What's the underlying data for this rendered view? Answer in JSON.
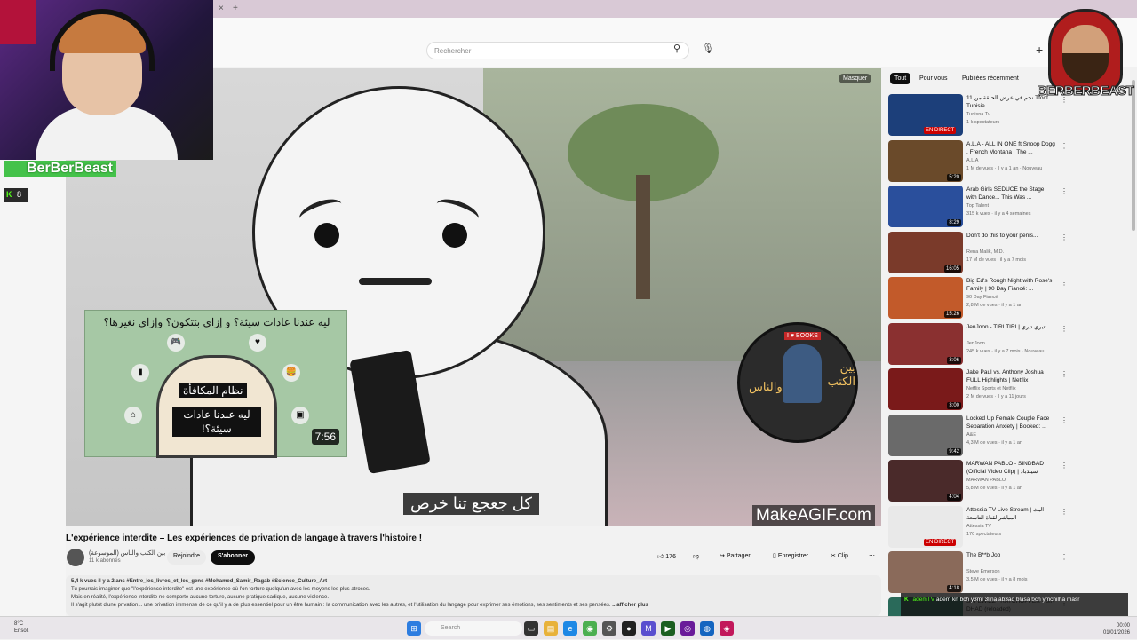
{
  "browser": {
    "tab_close": "×",
    "tab_new": "+"
  },
  "youtube": {
    "search_placeholder": "Rechercher",
    "search_icon": "⚲",
    "mic_icon": "🎙",
    "create_icon": "+"
  },
  "player": {
    "hide_label": "Masquer",
    "subtitle": "كل جعجع تنا خرص",
    "watermark": "MakeAGIF.com",
    "overlay_thumb": {
      "title": "ليه عندنا عادات سيئة؟ و إزاي بتتكون؟ وإزاي نغيرها؟",
      "text1": "نظام المكافأة",
      "text2": "ليه عندنا عادات سيئة؟!",
      "duration": "7:56"
    },
    "channel_logo": {
      "books_label": "I ♥ BOOKS",
      "text_right": "بين الكتب",
      "text_left": "والناس"
    }
  },
  "video": {
    "title": "L'expérience interdite – Les expériences de privation de langage à travers l'histoire !",
    "channel_name": "بين الكتب والناس (الموسوعة)",
    "subscribers": "11 k abonnés",
    "join_label": "Rejoindre",
    "subscribe_label": "S'abonner",
    "likes": "176",
    "share_label": "Partager",
    "save_label": "Enregistrer",
    "clip_label": "Clip",
    "more_label": "⋯",
    "description": {
      "meta": "5,4 k vues  il y a 2 ans  #Entre_les_livres_et_les_gens #Mohamed_Samir_Ragab #Science_Culture_Art",
      "line1": "Tu pourrais imaginer que \"l'expérience interdite\" est une expérience où l'on torture quelqu'un avec les moyens les plus atroces.",
      "line2": "Mais en réalité, l'expérience interdite ne comporte aucune torture, aucune pratique sadique, aucune violence.",
      "line3": "Il s'agit plutôt d'une privation... une privation immense de ce qu'il y a de plus essentiel pour un être humain : la communication avec les autres, et l'utilisation du langage pour exprimer ses émotions, ses sentiments et ses pensées.",
      "more": "...afficher plus"
    }
  },
  "sidebar": {
    "chips": [
      "Tout",
      "Pour vous",
      "Publiées récemment"
    ],
    "recommendations": [
      {
        "title": "11 نجم في عرض الحلقة من Tfoot Tunisie",
        "channel": "Tunisna Tv",
        "meta": "1 k spectateurs",
        "badge": "EN DIRECT",
        "color": "#1c3f7a"
      },
      {
        "title": "A.L.A - ALL IN ONE ft Snoop Dogg , French Montana , The ...",
        "channel": "A.L.A",
        "meta": "1 M de vues · il y a 1 an · Nouveau",
        "badge": "5:20",
        "color": "#6a4a2a"
      },
      {
        "title": "Arab Girls SEDUCE the Stage with Dance... This Was ...",
        "channel": "Top Talent",
        "meta": "315 k vues · il y a 4 semaines",
        "badge": "8:29",
        "color": "#2a4f9c"
      },
      {
        "title": "Don't do this to your penis...",
        "channel": "Rena Malik, M.D.",
        "meta": "17 M de vues · il y a 7 mois",
        "badge": "16:05",
        "color": "#7a3a2a"
      },
      {
        "title": "Big Ed's Rough Night with Rose's Family | 90 Day Fiancé: ...",
        "channel": "90 Day Fiancé",
        "meta": "2,8 M de vues · il y a 1 an",
        "badge": "15:26",
        "color": "#c25a2a"
      },
      {
        "title": "JenJoon - TIRI TIRI | تيري تيري",
        "channel": "JenJoon",
        "meta": "245 k vues · il y a 7 mois · Nouveau",
        "badge": "3:06",
        "color": "#8a3030"
      },
      {
        "title": "Jake Paul vs. Anthony Joshua FULL Highlights | Netflix",
        "channel": "Netflix Sports et Netflix",
        "meta": "2 M de vues · il y a 11 jours",
        "badge": "3:00",
        "color": "#7a1a1a"
      },
      {
        "title": "Locked Up Female Couple Face Separation Anxiety | Booked: ...",
        "channel": "A&E",
        "meta": "4,3 M de vues · il y a 1 an",
        "badge": "9:42",
        "color": "#6a6a6a"
      },
      {
        "title": "MARWAN PABLO - SINDBAD (Official Video Clip) | سيندباد",
        "channel": "MARWAN PABLO",
        "meta": "5,8 M de vues · il y a 1 an",
        "badge": "4:04",
        "color": "#4a2a2a"
      },
      {
        "title": "Attessia TV Live Stream | البث المباشر لقناة التاسعة",
        "channel": "Attessia TV",
        "meta": "170 spectateurs",
        "badge": "EN DIRECT",
        "color": "#e9e9e9"
      },
      {
        "title": "The B**b Job",
        "channel": "Steve Emerson",
        "meta": "3,5 M de vues · il y a 8 mois",
        "badge": "4:18",
        "color": "#8a6a5a"
      },
      {
        "title": "SAFEWIZZ , RATCHOPPER - SIN DHAD (reloaded)",
        "channel": "",
        "meta": "",
        "badge": "",
        "color": "#2a6a5a"
      }
    ]
  },
  "stream_overlay": {
    "streamer_name": "BerBerBeast",
    "viewer_count": "8",
    "kick_icon": "K",
    "brand_name": "BERBERBEAST",
    "chat": [
      {
        "user": "ademTV",
        "text": "adem kn bch y3ml 3lina ab3ad blasa bch ymchilha masr"
      }
    ]
  },
  "taskbar": {
    "weather_temp": "8°C",
    "weather_desc": "Ensol.",
    "search_placeholder": "Search",
    "time": "00:00",
    "date": "01/01/2026"
  },
  "colors": {
    "subscribe_bg": "#0f0f0f",
    "live_badge": "#cc0000",
    "kick_green": "#53fc18",
    "brand_red": "#b01d1d"
  }
}
